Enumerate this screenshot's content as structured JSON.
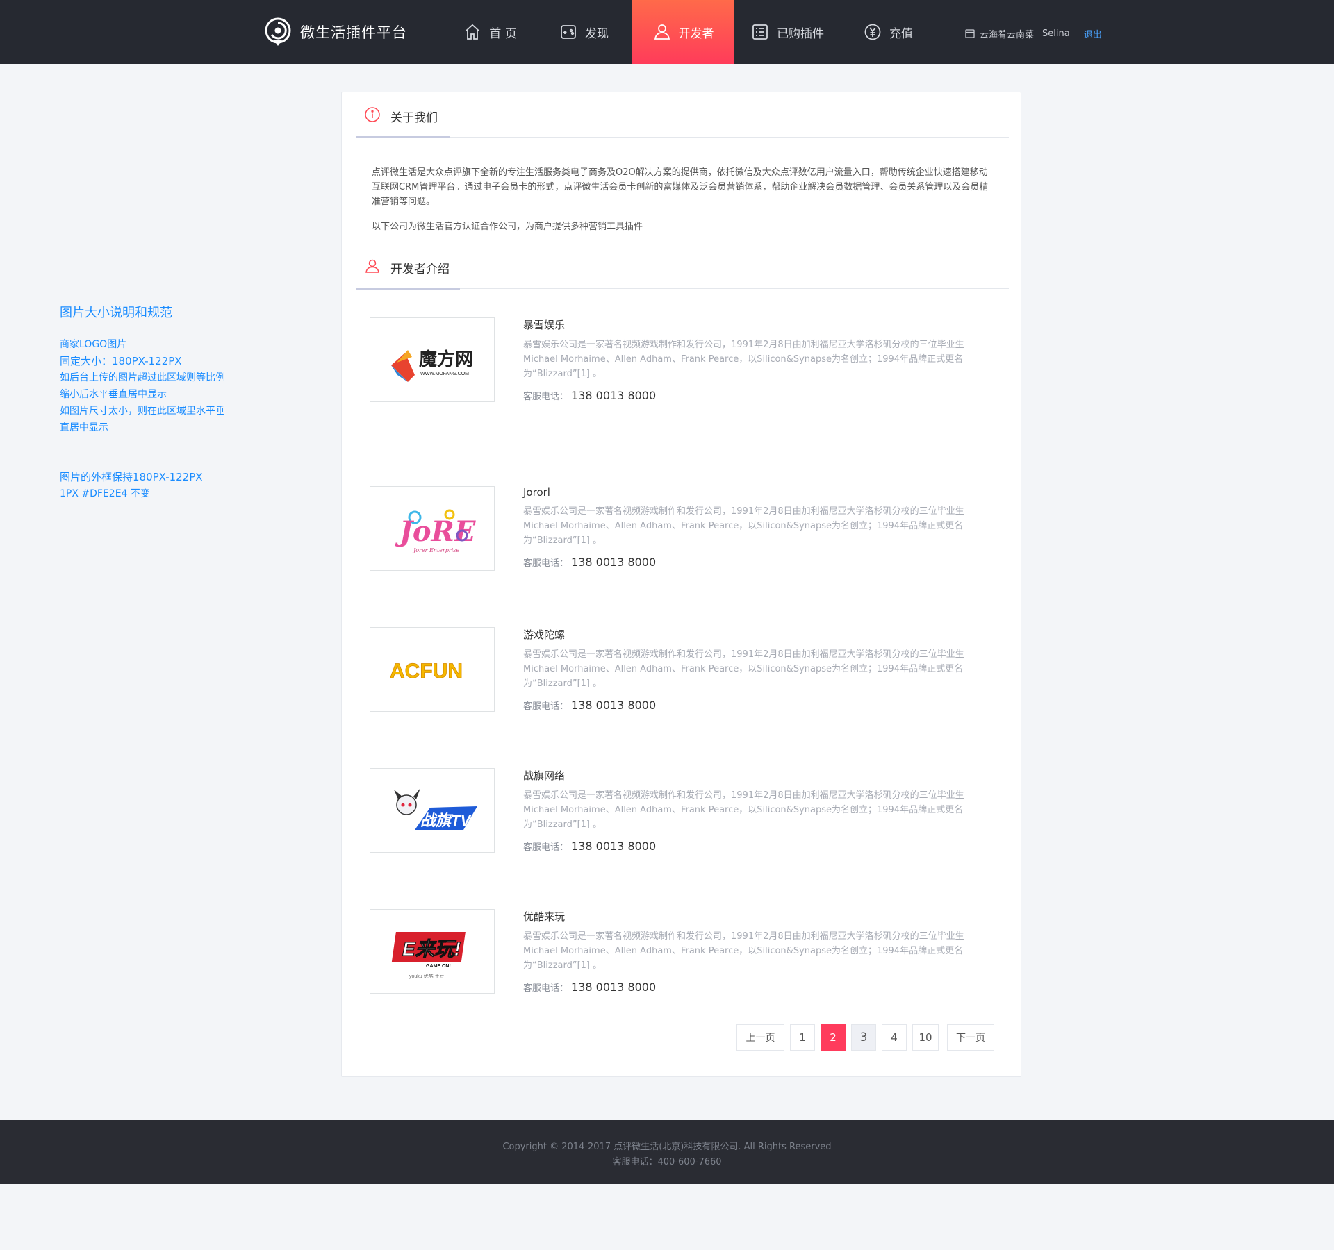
{
  "nav": {
    "brand": "微生活插件平台",
    "items": [
      {
        "label": "首 页"
      },
      {
        "label": "发现"
      },
      {
        "label": "开发者"
      },
      {
        "label": "已购插件"
      },
      {
        "label": "充值"
      }
    ],
    "store_name": "云海肴云南菜",
    "user_name": "Selina",
    "logout": "退出",
    "active_color": "#ff4a55"
  },
  "spec": {
    "title": "图片大小说明和规范",
    "lines": [
      "商家LOGO图片",
      "固定大小：180PX-122PX",
      "如后台上传的图片超过此区域则等比例",
      "缩小后水平垂直居中显示",
      "如图片尺寸太小，则在此区域里水平垂",
      "直居中显示"
    ],
    "lines2": [
      "图片的外框保持180PX-122PX",
      "1PX #DFE2E4 不变"
    ]
  },
  "about": {
    "title": "关于我们",
    "paragraph1": "点评微生活是大众点评旗下全新的专注生活服务类电子商务及O2O解决方案的提供商，依托微信及大众点评数亿用户流量入口，帮助传统企业快速搭建移动互联网CRM管理平台。通过电子会员卡的形式，点评微生活会员卡创新的富媒体及泛会员营销体系，帮助企业解决会员数据管理、会员关系管理以及会员精准营销等问题。",
    "paragraph2": "以下公司为微生活官方认证合作公司，为商户提供多种营销工具插件"
  },
  "developers": {
    "title": "开发者介绍",
    "phone_label": "客服电话：",
    "items": [
      {
        "name": "暴雪娱乐",
        "logo": "mofang-logo",
        "logo_text": "魔方网",
        "logo_sub": "WWW.MOFANG.COM",
        "desc": "暴雪娱乐公司是一家著名视频游戏制作和发行公司，1991年2月8日由加利福尼亚大学洛杉矶分校的三位毕业生Michael Morhaime、Allen Adham、Frank Pearce，以Silicon&Synapse为名创立；1994年品牌正式更名为“Blizzard”[1] 。",
        "phone": "138 0013 8000"
      },
      {
        "name": "Jororl",
        "logo": "jorer-logo",
        "logo_text": "JoRE",
        "logo_sub": "Jorer Enterprise",
        "desc": "暴雪娱乐公司是一家著名视频游戏制作和发行公司，1991年2月8日由加利福尼亚大学洛杉矶分校的三位毕业生Michael Morhaime、Allen Adham、Frank Pearce，以Silicon&Synapse为名创立；1994年品牌正式更名为“Blizzard”[1] 。",
        "phone": "138 0013 8000"
      },
      {
        "name": "游戏陀螺",
        "logo": "acfun-logo",
        "logo_text": "ACFUN",
        "logo_sub": "",
        "desc": "暴雪娱乐公司是一家著名视频游戏制作和发行公司，1991年2月8日由加利福尼亚大学洛杉矶分校的三位毕业生Michael Morhaime、Allen Adham、Frank Pearce，以Silicon&Synapse为名创立；1994年品牌正式更名为“Blizzard”[1] 。",
        "phone": "138 0013 8000"
      },
      {
        "name": "战旗网络",
        "logo": "zhanqi-logo",
        "logo_text": "战旗TV",
        "logo_sub": "",
        "desc": "暴雪娱乐公司是一家著名视频游戏制作和发行公司，1991年2月8日由加利福尼亚大学洛杉矶分校的三位毕业生Michael Morhaime、Allen Adham、Frank Pearce，以Silicon&Synapse为名创立；1994年品牌正式更名为“Blizzard”[1] 。",
        "phone": "138 0013 8000"
      },
      {
        "name": "优酷来玩",
        "logo": "youku-laiwan-logo",
        "logo_text": "E来玩!",
        "logo_sub": "GAME ON!",
        "logo_footer": "youku 优酷  土豆",
        "desc": "暴雪娱乐公司是一家著名视频游戏制作和发行公司，1991年2月8日由加利福尼亚大学洛杉矶分校的三位毕业生Michael Morhaime、Allen Adham、Frank Pearce，以Silicon&Synapse为名创立；1994年品牌正式更名为“Blizzard”[1] 。",
        "phone": "138 0013 8000"
      }
    ]
  },
  "pagination": {
    "prev": "上一页",
    "next": "下一页",
    "pages": [
      "1",
      "2",
      "3",
      "4",
      "10"
    ],
    "current": "2"
  },
  "footer": {
    "copyright": "Copyright © 2014-2017 点评微生活(北京)科技有限公司. All Rights Reserved",
    "hotline": "客服电话：400-600-7660"
  }
}
